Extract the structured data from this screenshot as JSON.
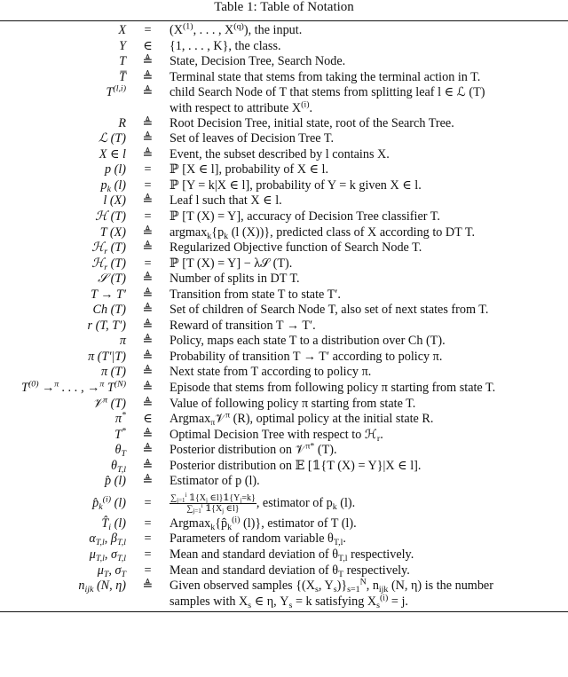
{
  "caption": "Table 1: Table of Notation",
  "rows": [
    {
      "symbol": "X",
      "rel": "=",
      "def": "(X^{(1)}, . . . , X^{(q)}), the input."
    },
    {
      "symbol": "Y",
      "rel": "∈",
      "def": "{1, . . . , K}, the class."
    },
    {
      "symbol": "T",
      "rel": "≜",
      "def": "State, Decision Tree, Search Node."
    },
    {
      "symbol": "T̅",
      "rel": "≜",
      "def": "Terminal state that stems from taking the terminal action in T."
    },
    {
      "symbol": "T^{(l,i)}",
      "rel": "≜",
      "def": "child Search Node of T that stems from splitting leaf l ∈ ℒ (T)",
      "def2": "with respect to attribute X^{(i)}."
    },
    {
      "symbol": "R",
      "rel": "≜",
      "def": "Root Decision Tree, initial state, root of the Search Tree."
    },
    {
      "symbol": "ℒ (T)",
      "rel": "≜",
      "def": "Set of leaves of Decision Tree T."
    },
    {
      "symbol": "X ∈ l",
      "rel": "≜",
      "def": "Event, the subset described by l contains X."
    },
    {
      "symbol": "p (l)",
      "rel": "=",
      "def": "ℙ [X ∈ l], probability of X ∈ l."
    },
    {
      "symbol": "p_{k} (l)",
      "rel": "=",
      "def": "ℙ [Y = k|X ∈ l], probability of Y = k given X ∈ l."
    },
    {
      "symbol": "l (X)",
      "rel": "≜",
      "def": "Leaf l such that X ∈ l."
    },
    {
      "symbol": "ℋ (T)",
      "rel": "=",
      "def": "ℙ [T (X) = Y], accuracy of Decision Tree classifier T."
    },
    {
      "symbol": "T (X)",
      "rel": "≜",
      "def": "argmax_{k}{p_{k} (l (X))}, predicted class of X according to DT T."
    },
    {
      "symbol": "ℋ_{r} (T)",
      "rel": "≜",
      "def": "Regularized Objective function of Search Node T."
    },
    {
      "symbol": "ℋ_{r} (T)",
      "rel": "=",
      "def": "ℙ [T (X) = Y] − λ𝒮 (T)."
    },
    {
      "symbol": "𝒮 (T)",
      "rel": "≜",
      "def": "Number of splits in DT T."
    },
    {
      "symbol": "T → T′",
      "rel": "≜",
      "def": "Transition from state T to state T′."
    },
    {
      "symbol": "Ch (T)",
      "rel": "≜",
      "def": "Set of children of Search Node T, also set of next states from T."
    },
    {
      "symbol": "r (T, T′)",
      "rel": "≜",
      "def": "Reward of transition T → T′."
    },
    {
      "symbol": "π",
      "rel": "≜",
      "def": "Policy, maps each state T to a distribution over Ch (T)."
    },
    {
      "symbol": "π (T′|T)",
      "rel": "≜",
      "def": "Probability of transition T → T′ according to policy π."
    },
    {
      "symbol": "π (T)",
      "rel": "≜",
      "def": "Next state from T according to policy π."
    },
    {
      "symbol": "T^{(0)} →^{π} . . . , →^{π} T^{(N)}",
      "rel": "≜",
      "def": "Episode that stems from following policy π starting from state T."
    },
    {
      "symbol": "𝒱^{π} (T)",
      "rel": "≜",
      "def": "Value of following policy π starting from state T."
    },
    {
      "symbol": "π^{*}",
      "rel": "∈",
      "def": "Argmax_{π}𝒱^{π} (R), optimal policy at the initial state R."
    },
    {
      "symbol": "T^{*}",
      "rel": "≜",
      "def": "Optimal Decision Tree with respect to ℋ_{r}."
    },
    {
      "symbol": "θ_{T}",
      "rel": "≜",
      "def": "Posterior distribution on 𝒱^{π*} (T)."
    },
    {
      "symbol": "θ_{T,l}",
      "rel": "≜",
      "def": "Posterior distribution on 𝔼 [𝟙{T (X) = Y}|X ∈ l]."
    },
    {
      "symbol": "p̂ (l)",
      "rel": "≜",
      "def": "Estimator of p (l)."
    },
    {
      "symbol": "p̂_{k}^{(i)} (l)",
      "rel": "=",
      "def": "\\frac{∑_{j=1}^{i} 𝟙{X_{j} ∈l}𝟙{Y_{j}=k}}{∑_{j=1}^{i} 𝟙{X_{j} ∈l}}, estimator of p_{k} (l).",
      "tall": true
    },
    {
      "symbol": "T̂_{i} (l)",
      "rel": "=",
      "def": "Argmax_{k}{p̂_{k}^{(i)} (l)}, estimator of T (l)."
    },
    {
      "symbol": "α_{T,l}, β_{T,l}",
      "rel": "=",
      "def": "Parameters of random variable θ_{T,l}."
    },
    {
      "symbol": "μ_{T,l}, σ_{T,l}",
      "rel": "=",
      "def": "Mean and standard deviation of θ_{T,l} respectively."
    },
    {
      "symbol": "μ_{T}, σ_{T}",
      "rel": "=",
      "def": "Mean and standard deviation of θ_{T} respectively."
    },
    {
      "symbol": "n_{ijk} (N, η)",
      "rel": "≜",
      "def": "Given observed samples {(X_{s}, Y_{s})}_{s=1}^{N}, n_{ijk} (N, η) is the number",
      "def2": "samples with X_{s} ∈ η, Y_{s} = k satisfying X_{s}^{(i)} = j."
    }
  ]
}
